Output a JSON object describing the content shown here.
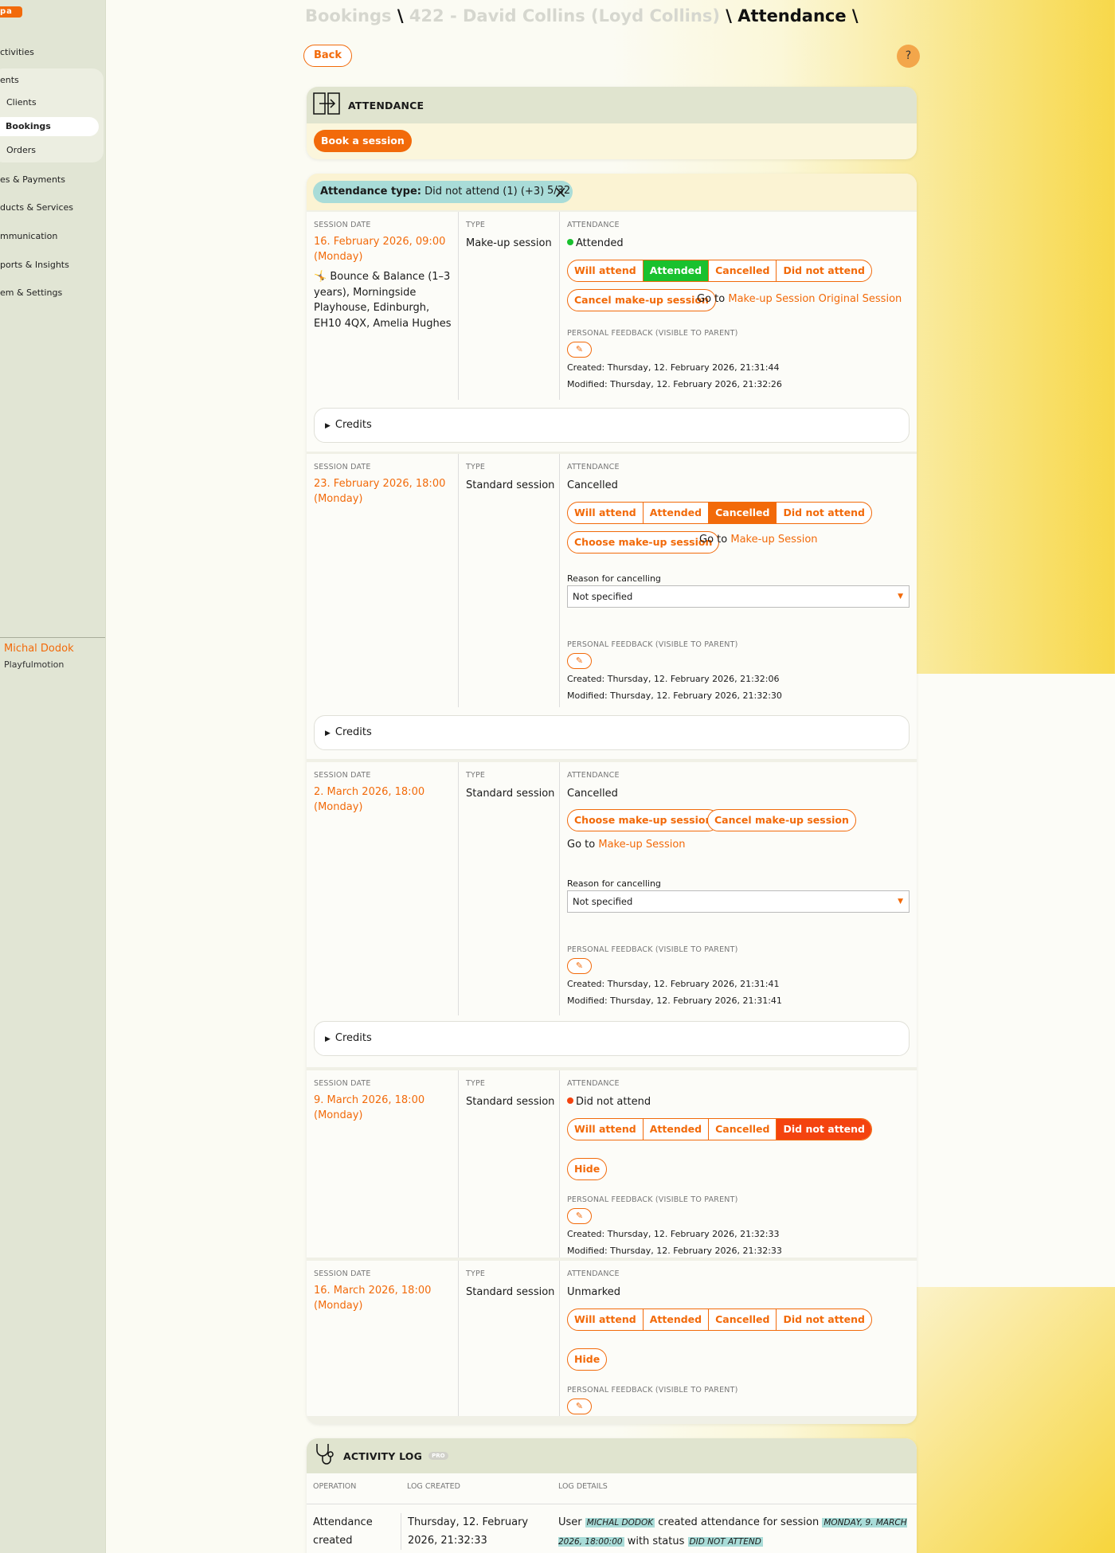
{
  "sidebar": {
    "logo": "pa",
    "items": [
      "ctivities",
      "ents",
      "es & Payments",
      "ducts & Services",
      "mmunication",
      "ports & Insights",
      "em & Settings"
    ],
    "sub_items": [
      "Clients",
      "Bookings",
      "Orders"
    ],
    "user_name": "Michal Dodok",
    "org_name": "Playfulmotion"
  },
  "breadcrumb": {
    "part1": "Bookings",
    "part2": "422 - David Collins (Loyd Collins)",
    "current": "Attendance",
    "sep": "\\"
  },
  "header": {
    "back": "Back",
    "help": "?"
  },
  "attendance_card": {
    "title": "ATTENDANCE",
    "book": "Book a session"
  },
  "filter": {
    "label": "Attendance type:",
    "value": "Did not attend (1) (+3)",
    "count": "5/32"
  },
  "labels": {
    "session_date": "SESSION DATE",
    "type": "TYPE",
    "attendance": "ATTENDANCE",
    "feedback": "PERSONAL FEEDBACK (VISIBLE TO PARENT)",
    "reason": "Reason for cancelling",
    "credits": "Credits",
    "go_to": "Go to",
    "will_attend": "Will attend",
    "attended": "Attended",
    "cancelled": "Cancelled",
    "did_not_attend": "Did not attend",
    "hide": "Hide",
    "choose_makeup": "Choose make-up session",
    "cancel_makeup": "Cancel make-up session"
  },
  "sessions": [
    {
      "date": "16. February 2026, 09:00 (Monday)",
      "detail": "🤸 Bounce & Balance (1–3 years), Morningside Playhouse, Edinburgh, EH10 4QX, Amelia Hughes",
      "type": "Make-up session",
      "status": "Attended",
      "link": "Make-up Session Original Session",
      "reason": "",
      "created": "Created: Thursday, 12. February 2026, 21:31:44",
      "modified": "Modified: Thursday, 12. February 2026, 21:32:26"
    },
    {
      "date": "23. February 2026, 18:00 (Monday)",
      "type": "Standard session",
      "status": "Cancelled",
      "link": "Make-up Session",
      "reason": "Not specified",
      "created": "Created: Thursday, 12. February 2026, 21:32:06",
      "modified": "Modified: Thursday, 12. February 2026, 21:32:30"
    },
    {
      "date": "2. March 2026, 18:00 (Monday)",
      "type": "Standard session",
      "status": "Cancelled",
      "link": "Make-up Session",
      "reason": "Not specified",
      "created": "Created: Thursday, 12. February 2026, 21:31:41",
      "modified": "Modified: Thursday, 12. February 2026, 21:31:41"
    },
    {
      "date": "9. March 2026, 18:00 (Monday)",
      "type": "Standard session",
      "status": "Did not attend",
      "created": "Created: Thursday, 12. February 2026, 21:32:33",
      "modified": "Modified: Thursday, 12. February 2026, 21:32:33"
    },
    {
      "date": "16. March 2026, 18:00 (Monday)",
      "type": "Standard session",
      "status": "Unmarked"
    }
  ],
  "activity_log": {
    "title": "ACTIVITY LOG",
    "badge": "PRO",
    "col_operation": "OPERATION",
    "col_created": "LOG CREATED",
    "col_details": "LOG DETAILS",
    "row": {
      "operation": "Attendance created",
      "created": "Thursday, 12. February 2026, 21:32:33",
      "d1": "User",
      "user": "MICHAL DODOK",
      "d2": "created attendance for session",
      "session": "MONDAY, 9. MARCH 2026, 18:00:00",
      "d3": "with status",
      "status": "DID NOT ATTEND"
    }
  },
  "colors": {
    "accent": "#f26a0a",
    "attended": "#19c12e",
    "not_attended": "#f4430f",
    "chip": "#a9dcd8"
  },
  "icons": [
    "door-arrow-icon",
    "stethoscope-icon",
    "pencil-icon",
    "close-icon",
    "triangle-right-icon",
    "caret-down-icon"
  ]
}
